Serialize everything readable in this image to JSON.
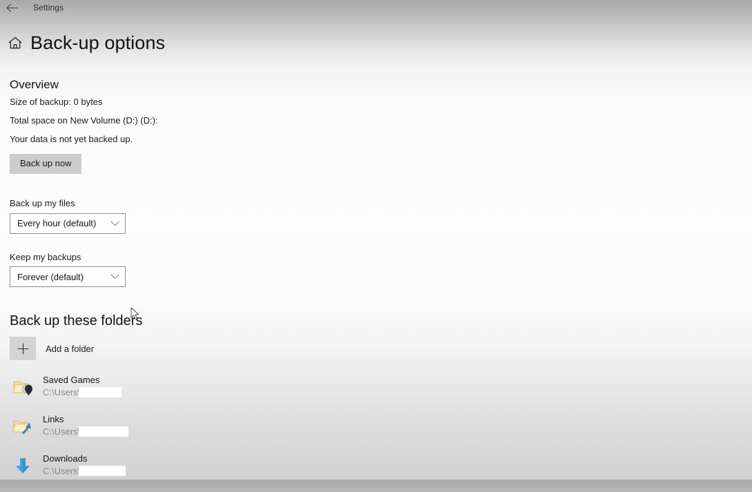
{
  "titlebar": {
    "back_icon": "back-arrow-icon",
    "label": "Settings"
  },
  "header": {
    "home_icon": "home-icon",
    "title": "Back-up options"
  },
  "overview": {
    "heading": "Overview",
    "size_of_backup": "Size of backup: 0 bytes",
    "total_space": "Total space on New Volume (D:) (D:):",
    "status": "Your data is not yet backed up.",
    "backup_button": "Back up now"
  },
  "backup_files": {
    "label": "Back up my files",
    "selected": "Every hour (default)",
    "chevron_icon": "chevron-down-icon"
  },
  "keep_backups": {
    "label": "Keep my backups",
    "selected": "Forever (default)",
    "chevron_icon": "chevron-down-icon"
  },
  "folders": {
    "heading": "Back up these folders",
    "add_label": "Add a folder",
    "add_icon": "plus-icon",
    "items": [
      {
        "name": "Saved Games",
        "path": "C:\\Users\\",
        "icon": "saved-games-folder-icon"
      },
      {
        "name": "Links",
        "path": "C:\\Users\\",
        "icon": "links-folder-icon"
      },
      {
        "name": "Downloads",
        "path": "C:\\Users\\",
        "icon": "downloads-arrow-icon"
      }
    ]
  },
  "colors": {
    "button_gray": "#cccccc",
    "combo_border": "#8d8d8d",
    "path_gray": "#8a8a8a",
    "folder_yellow": "#f3d08a",
    "downloads_blue": "#2f8fd4"
  }
}
